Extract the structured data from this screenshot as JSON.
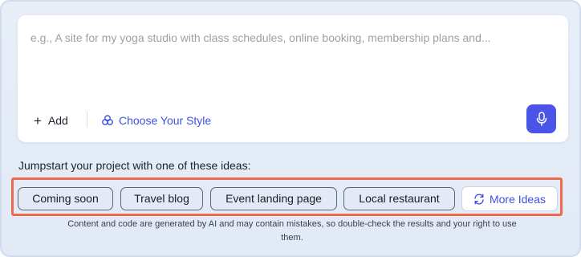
{
  "prompt": {
    "placeholder": "e.g., A site for my yoga studio with class schedules, online booking, membership plans and...",
    "value": ""
  },
  "toolbar": {
    "add_label": "Add",
    "add_icon": "plus-icon",
    "style_label": "Choose Your Style",
    "style_icon": "palette-icon",
    "mic_icon": "microphone-icon"
  },
  "ideas": {
    "heading": "Jumpstart your project with one of these ideas:",
    "chips": [
      "Coming soon",
      "Travel blog",
      "Event landing page",
      "Local restaurant"
    ],
    "more_label": "More Ideas",
    "more_icon": "refresh-icon"
  },
  "disclaimer": "Content and code are generated by AI and may contain mistakes, so double-check the results and your right to use them.",
  "colors": {
    "accent": "#4a55e8",
    "link": "#3b52e0",
    "highlight_frame": "#ee6a4f",
    "chip_bg": "#e3eaf5"
  }
}
